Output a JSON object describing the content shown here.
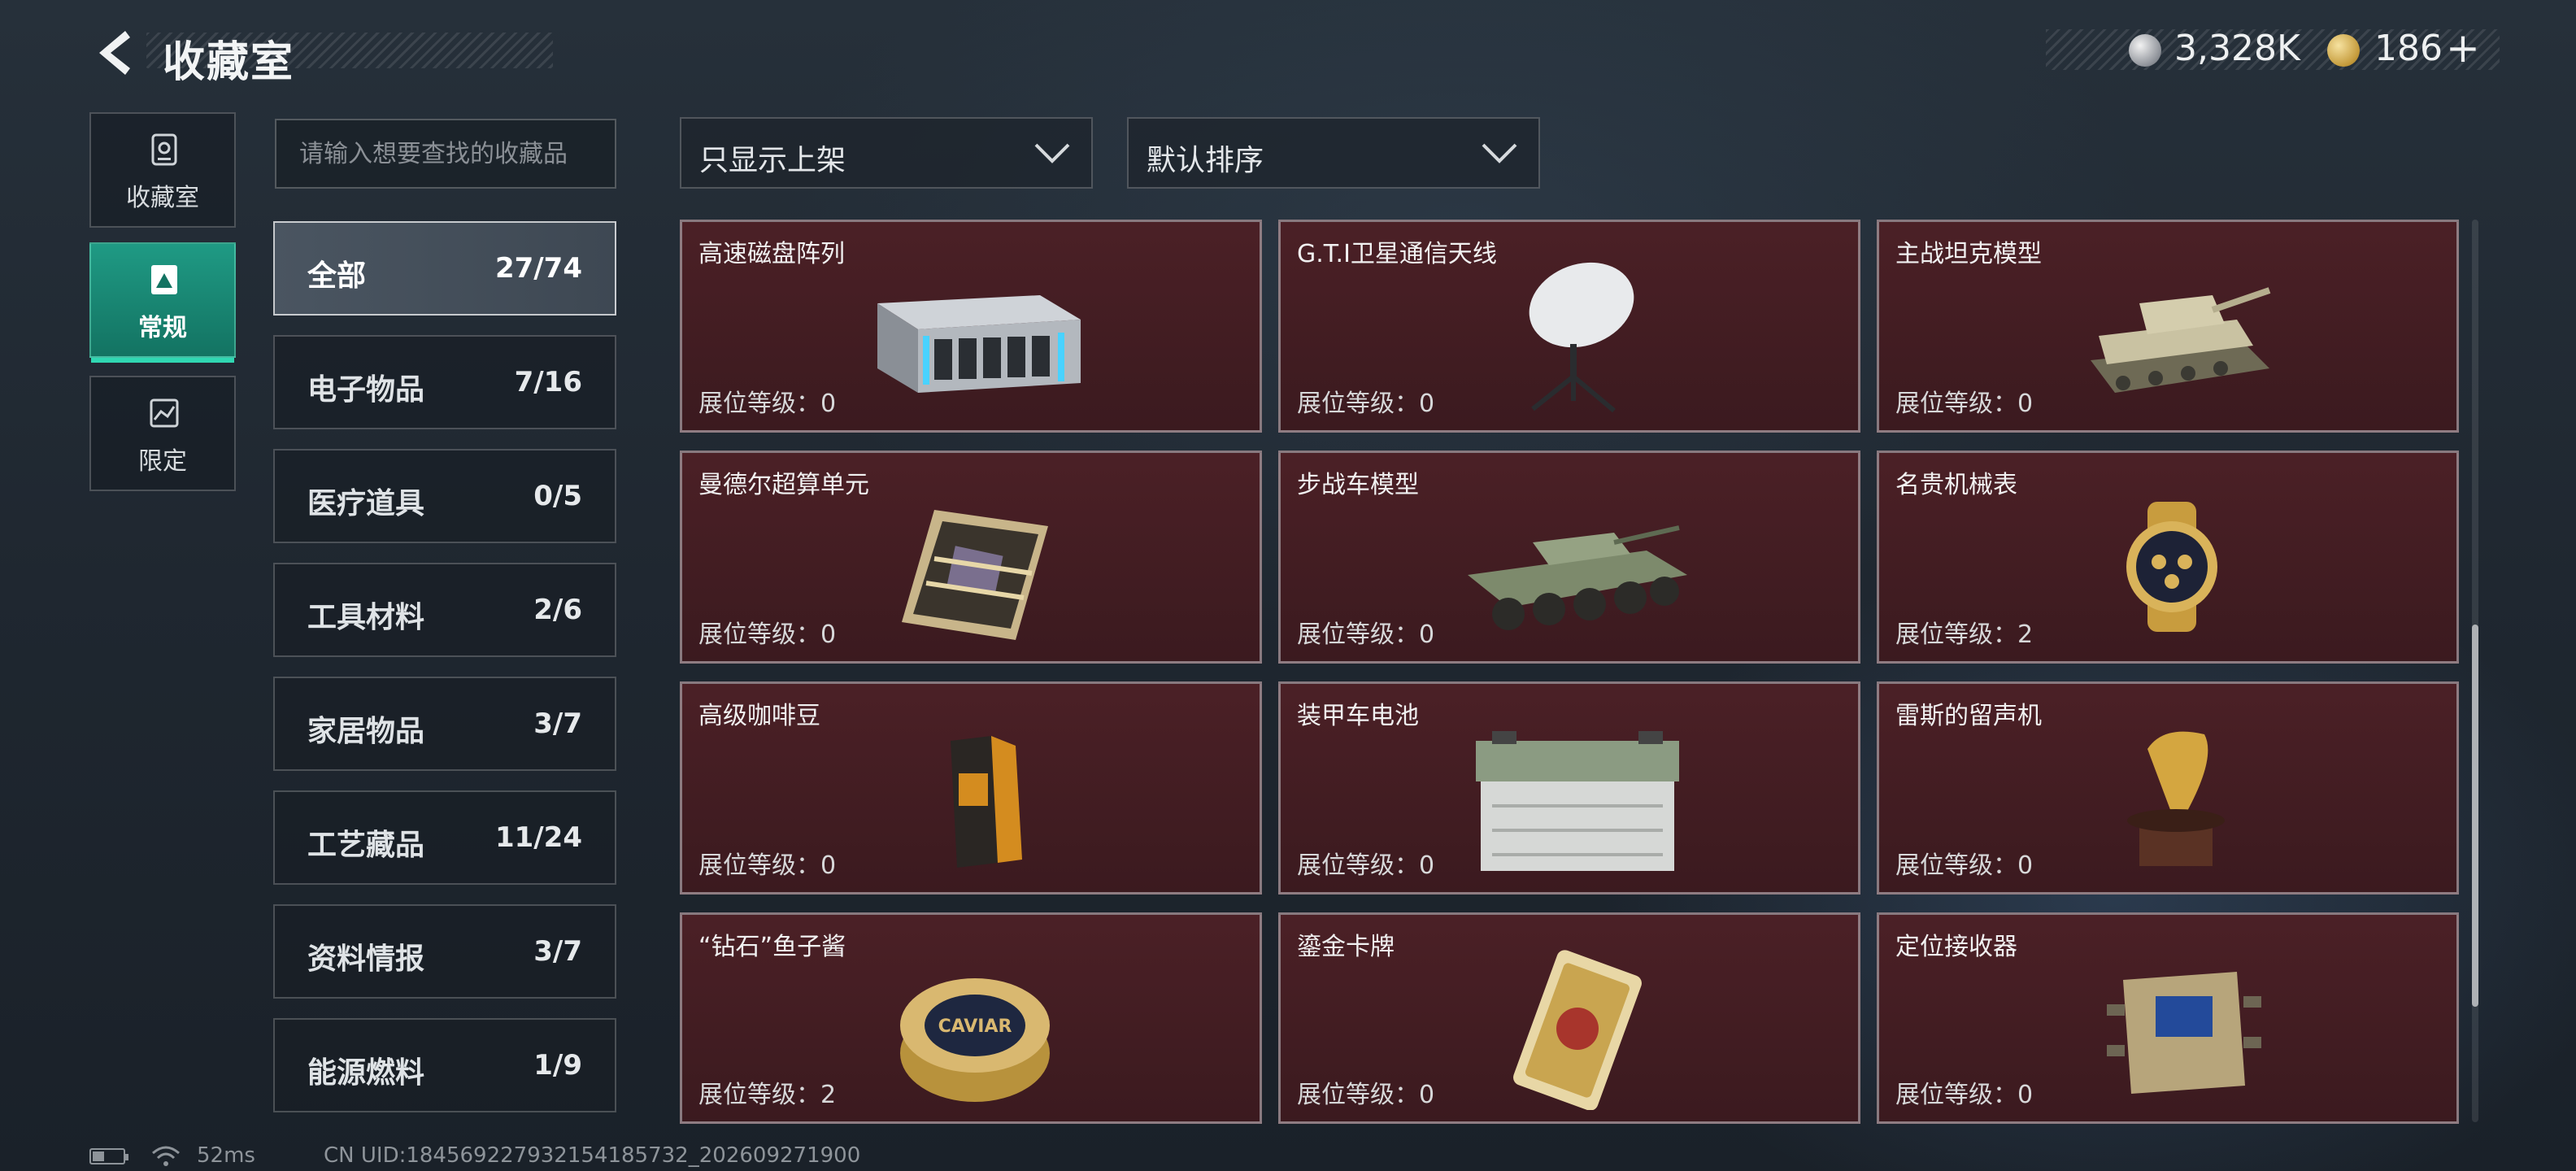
{
  "header": {
    "title": "收藏室",
    "currencies": [
      {
        "icon": "silver-coin-icon",
        "value": "3,328K"
      },
      {
        "icon": "gold-coin-icon",
        "value": "186"
      }
    ],
    "add_label": "+"
  },
  "nav": {
    "tabs": [
      {
        "label": "收藏室",
        "icon": "collection-room-icon"
      },
      {
        "label": "常规",
        "icon": "regular-icon",
        "active": true
      },
      {
        "label": "限定",
        "icon": "limited-icon"
      }
    ]
  },
  "search": {
    "placeholder": "请输入想要查找的收藏品",
    "value": ""
  },
  "categories": [
    {
      "name": "全部",
      "count": "27/74",
      "active": true
    },
    {
      "name": "电子物品",
      "count": "7/16"
    },
    {
      "name": "医疗道具",
      "count": "0/5"
    },
    {
      "name": "工具材料",
      "count": "2/6"
    },
    {
      "name": "家居物品",
      "count": "3/7"
    },
    {
      "name": "工艺藏品",
      "count": "11/24"
    },
    {
      "name": "资料情报",
      "count": "3/7"
    },
    {
      "name": "能源燃料",
      "count": "1/9"
    }
  ],
  "filters": {
    "shelf_filter": "只显示上架",
    "sort": "默认排序"
  },
  "items": [
    {
      "name": "高速磁盘阵列",
      "level": "展位等级：0",
      "icon": "disk-array-icon"
    },
    {
      "name": "G.T.I卫星通信天线",
      "level": "展位等级：0",
      "icon": "satellite-antenna-icon"
    },
    {
      "name": "主战坦克模型",
      "level": "展位等级：0",
      "icon": "tank-model-icon"
    },
    {
      "name": "曼德尔超算单元",
      "level": "展位等级：0",
      "icon": "supercompute-unit-icon"
    },
    {
      "name": "步战车模型",
      "level": "展位等级：0",
      "icon": "ifv-model-icon"
    },
    {
      "name": "名贵机械表",
      "level": "展位等级：2",
      "icon": "mechanical-watch-icon"
    },
    {
      "name": "高级咖啡豆",
      "level": "展位等级：0",
      "icon": "coffee-beans-icon"
    },
    {
      "name": "装甲车电池",
      "level": "展位等级：0",
      "icon": "vehicle-battery-icon"
    },
    {
      "name": "雷斯的留声机",
      "level": "展位等级：0",
      "icon": "gramophone-icon"
    },
    {
      "name": "“钻石”鱼子酱",
      "level": "展位等级：2",
      "icon": "caviar-tin-icon"
    },
    {
      "name": "鎏金卡牌",
      "level": "展位等级：0",
      "icon": "gilded-card-icon"
    },
    {
      "name": "定位接收器",
      "level": "展位等级：0",
      "icon": "locator-receiver-icon"
    }
  ],
  "item_art_text": {
    "caviar": "CAVIAR"
  },
  "status_bar": {
    "ping": "52ms",
    "uid": "CN UID:18456922793215418573​2_202609271900"
  },
  "colors": {
    "accent": "#1f9a84",
    "card_bg": "#4b2026"
  }
}
